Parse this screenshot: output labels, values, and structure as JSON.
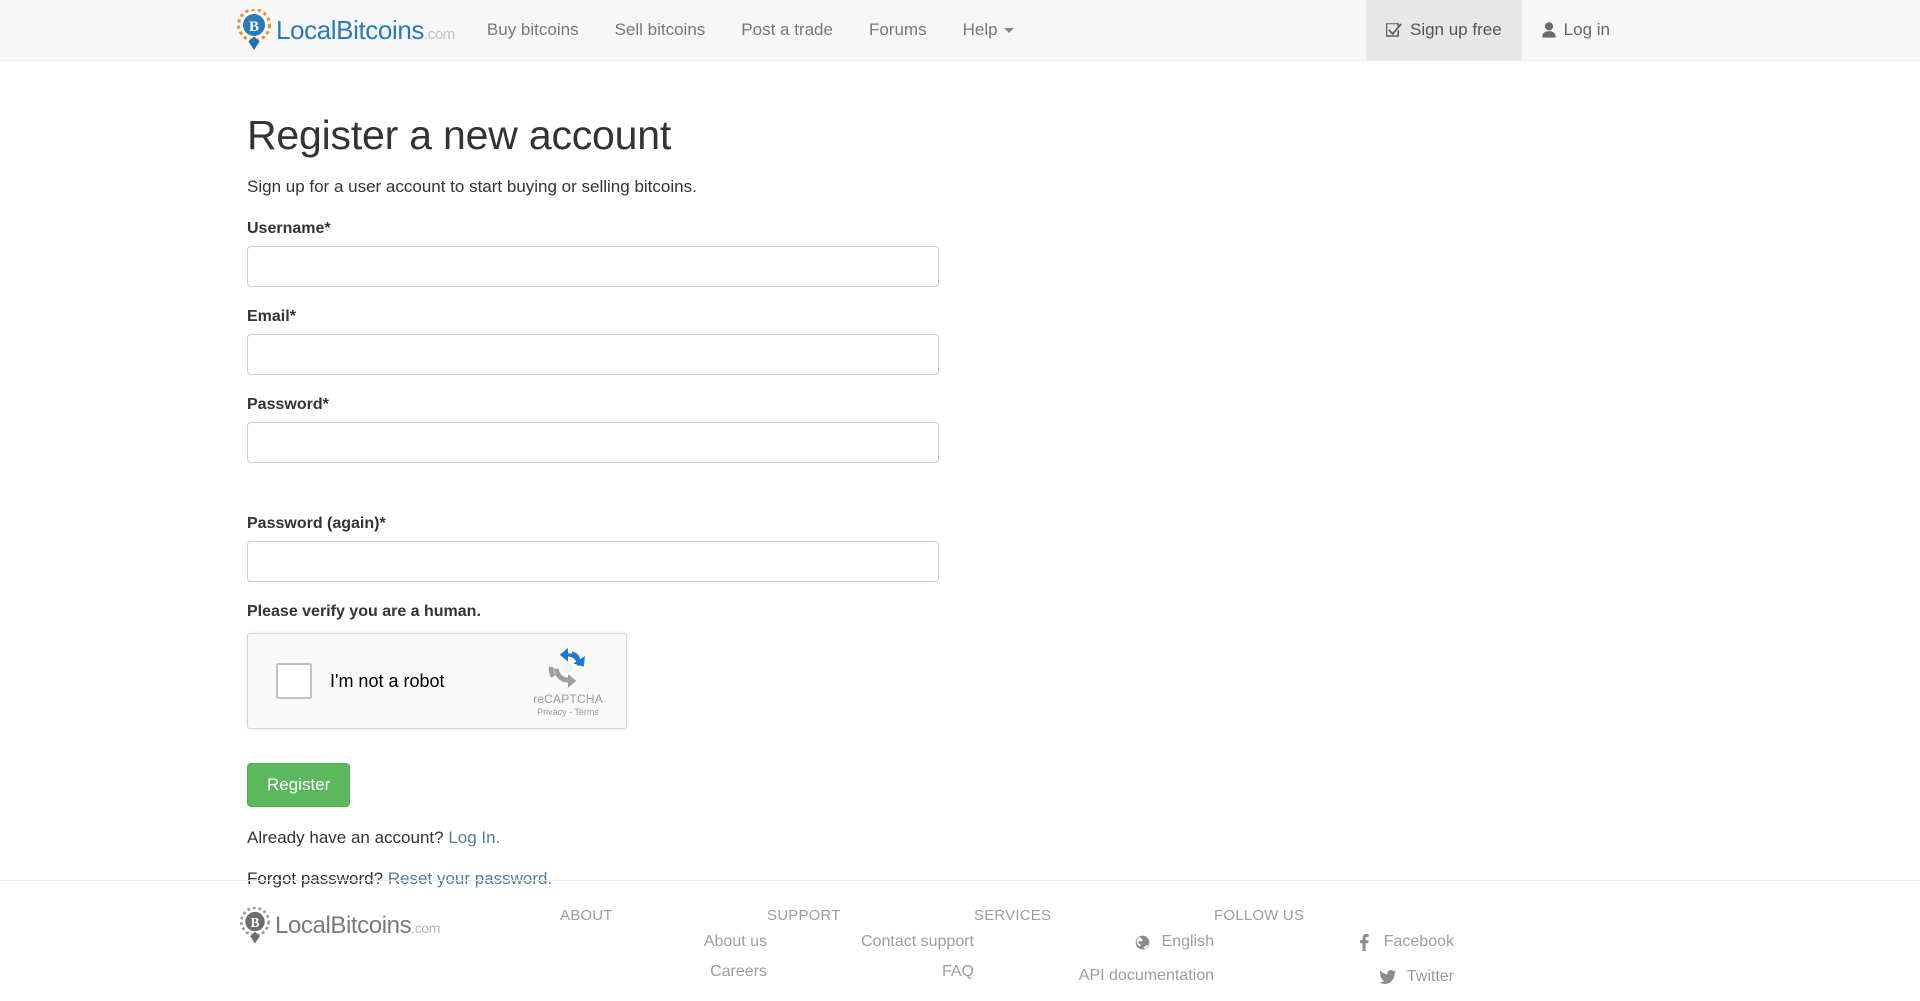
{
  "header": {
    "brand": {
      "name": "LocalBitcoins",
      "suffix": ".com"
    },
    "nav": [
      {
        "label": "Buy bitcoins"
      },
      {
        "label": "Sell bitcoins"
      },
      {
        "label": "Post a trade"
      },
      {
        "label": "Forums"
      },
      {
        "label": "Help",
        "caret": true
      }
    ],
    "right": [
      {
        "label": "Sign up free",
        "icon": "check-square-icon",
        "active": true
      },
      {
        "label": "Log in",
        "icon": "user-icon",
        "active": false
      }
    ]
  },
  "main": {
    "title": "Register a new account",
    "lead": "Sign up for a user account to start buying or selling bitcoins.",
    "fields": [
      {
        "label": "Username*",
        "value": "",
        "placeholder": ""
      },
      {
        "label": "Email*",
        "value": "",
        "placeholder": ""
      },
      {
        "label": "Password*",
        "value": "",
        "placeholder": ""
      },
      {
        "label": "Password (again)*",
        "value": "",
        "placeholder": ""
      }
    ],
    "verify_label": "Please verify you are a human.",
    "recaptcha": {
      "checkbox_label": "I'm not a robot",
      "brand": "reCAPTCHA",
      "legal": "Privacy - Terms"
    },
    "submit_label": "Register",
    "already_text": "Already have an account?",
    "already_link": "Log In.",
    "forgot_text": "Forgot password?",
    "forgot_link": "Reset your password."
  },
  "footer": {
    "brand": {
      "name": "LocalBitcoins",
      "suffix": ".com"
    },
    "columns": [
      {
        "title": "ABOUT",
        "links": [
          {
            "label": "About us",
            "icon": ""
          },
          {
            "label": "Careers",
            "icon": ""
          }
        ]
      },
      {
        "title": "SUPPORT",
        "links": [
          {
            "label": "Contact support",
            "icon": ""
          },
          {
            "label": "FAQ",
            "icon": ""
          }
        ]
      },
      {
        "title": "SERVICES",
        "links": [
          {
            "label": "English",
            "icon": "globe-icon"
          },
          {
            "label": "API documentation",
            "icon": ""
          }
        ]
      },
      {
        "title": "FOLLOW US",
        "links": [
          {
            "label": "Facebook",
            "icon": "facebook-icon"
          },
          {
            "label": "Twitter",
            "icon": "twitter-icon"
          }
        ]
      }
    ]
  },
  "colors": {
    "brand_blue": "#2a7ab9",
    "link_blue": "#4f7f9d",
    "register_green": "#5cb85c",
    "header_bg": "#f7f7f7",
    "muted": "#9d9d9d"
  }
}
